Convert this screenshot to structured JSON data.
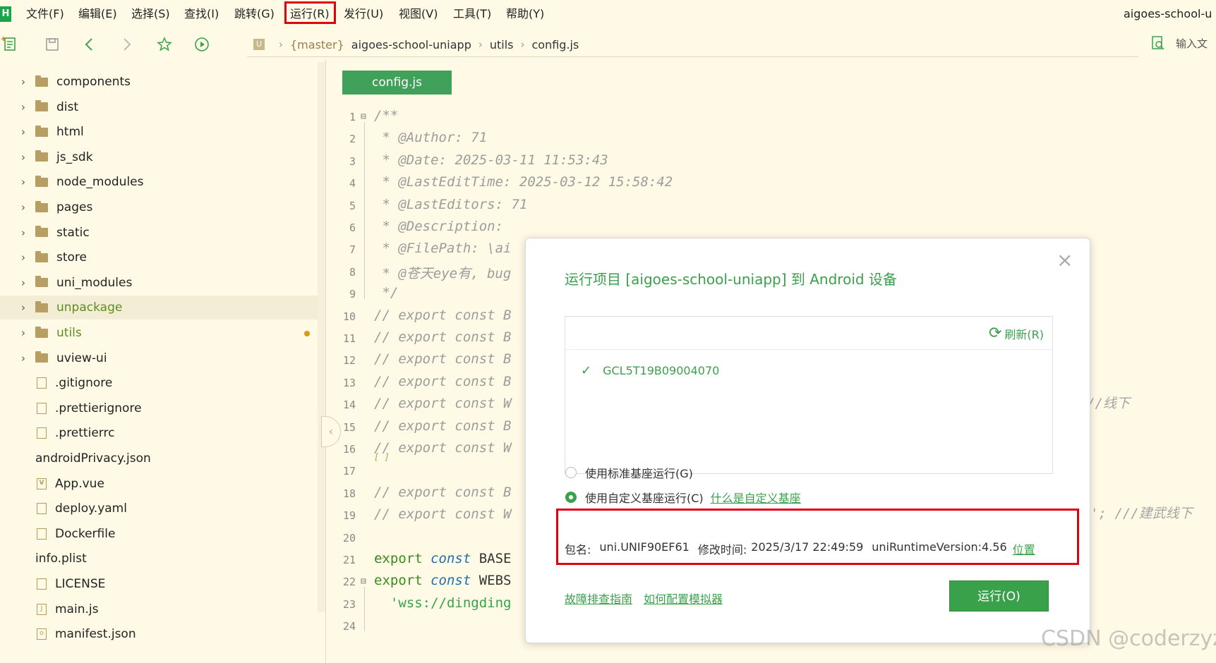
{
  "menubar": {
    "logo": "H",
    "items": [
      "文件(F)",
      "编辑(E)",
      "选择(S)",
      "查找(I)",
      "跳转(G)",
      "运行(R)",
      "发行(U)",
      "视图(V)",
      "工具(T)",
      "帮助(Y)"
    ],
    "window_title": "aigoes-school-u"
  },
  "toolbar": {
    "breadcrumb": {
      "u_icon": "U",
      "branch": "{master}",
      "project": "aigoes-school-uniapp",
      "folder": "utils",
      "file": "config.js"
    },
    "search_placeholder": "输入文"
  },
  "sidebar": {
    "items": [
      {
        "label": "components",
        "type": "folder"
      },
      {
        "label": "dist",
        "type": "folder"
      },
      {
        "label": "html",
        "type": "folder"
      },
      {
        "label": "js_sdk",
        "type": "folder"
      },
      {
        "label": "node_modules",
        "type": "folder"
      },
      {
        "label": "pages",
        "type": "folder"
      },
      {
        "label": "static",
        "type": "folder"
      },
      {
        "label": "store",
        "type": "folder"
      },
      {
        "label": "uni_modules",
        "type": "folder"
      },
      {
        "label": "unpackage",
        "type": "folder",
        "selected": true
      },
      {
        "label": "utils",
        "type": "folder",
        "modified": true
      },
      {
        "label": "uview-ui",
        "type": "folder"
      },
      {
        "label": ".gitignore",
        "type": "file"
      },
      {
        "label": ".prettierignore",
        "type": "file"
      },
      {
        "label": ".prettierrc",
        "type": "file"
      },
      {
        "label": "androidPrivacy.json",
        "type": "json"
      },
      {
        "label": "App.vue",
        "type": "vue"
      },
      {
        "label": "deploy.yaml",
        "type": "file"
      },
      {
        "label": "Dockerfile",
        "type": "file"
      },
      {
        "label": "info.plist",
        "type": "code"
      },
      {
        "label": "LICENSE",
        "type": "file"
      },
      {
        "label": "main.js",
        "type": "js"
      },
      {
        "label": "manifest.json",
        "type": "manifest"
      }
    ]
  },
  "editor": {
    "tab": "config.js",
    "lines": [
      {
        "n": "1",
        "text": "/**"
      },
      {
        "n": "2",
        "text": " * @Author: 71"
      },
      {
        "n": "3",
        "text": " * @Date: 2025-03-11 11:53:43"
      },
      {
        "n": "4",
        "text": " * @LastEditTime: 2025-03-12 15:58:42"
      },
      {
        "n": "5",
        "text": " * @LastEditors: 71"
      },
      {
        "n": "6",
        "text": " * @Description:"
      },
      {
        "n": "7",
        "text": " * @FilePath: \\ai"
      },
      {
        "n": "8",
        "text": " * @苍天eye有, bug"
      },
      {
        "n": "9",
        "text": " */"
      },
      {
        "n": "10",
        "text": "// export const B"
      },
      {
        "n": "11",
        "text": "// export const B"
      },
      {
        "n": "12",
        "text": "// export const B"
      },
      {
        "n": "13",
        "text": "// export const B"
      },
      {
        "n": "14",
        "text": "// export const W"
      },
      {
        "n": "15",
        "text": "// export const B"
      },
      {
        "n": "16",
        "text": "// export const W"
      },
      {
        "n": "17",
        "text": ""
      },
      {
        "n": "18",
        "text": "// export const B"
      },
      {
        "n": "19",
        "text": "// export const W"
      },
      {
        "n": "20",
        "text": ""
      },
      {
        "n": "21",
        "text": "export const BASE"
      },
      {
        "n": "22",
        "text": "export const WEBS"
      },
      {
        "n": "23",
        "text": "  'wss://dingding"
      },
      {
        "n": "24",
        "text": ""
      }
    ],
    "right_comment_14": "//线下",
    "right_comment_19": "'; ///建武线下"
  },
  "dialog": {
    "title": "运行项目 [aigoes-school-uniapp] 到 Android 设备",
    "close": "×",
    "refresh_label": "刷新(R)",
    "device_id": "GCL5T19B09004070",
    "standard_option": "使用标准基座运行(G)",
    "custom_option": "使用自定义基座运行(C)",
    "custom_help_link": "什么是自定义基座",
    "package_label": "包名:",
    "package_name": "uni.UNIF90EF61",
    "modified_label": "修改时间:",
    "modified_time": "2025/3/17 22:49:59",
    "runtime_version": "uniRuntimeVersion:4.56",
    "location_link": "位置",
    "troubleshoot_link": "故障排查指南",
    "emulator_link": "如何配置模拟器",
    "run_button": "运行(O)"
  },
  "watermark": "CSDN @coderzyz"
}
